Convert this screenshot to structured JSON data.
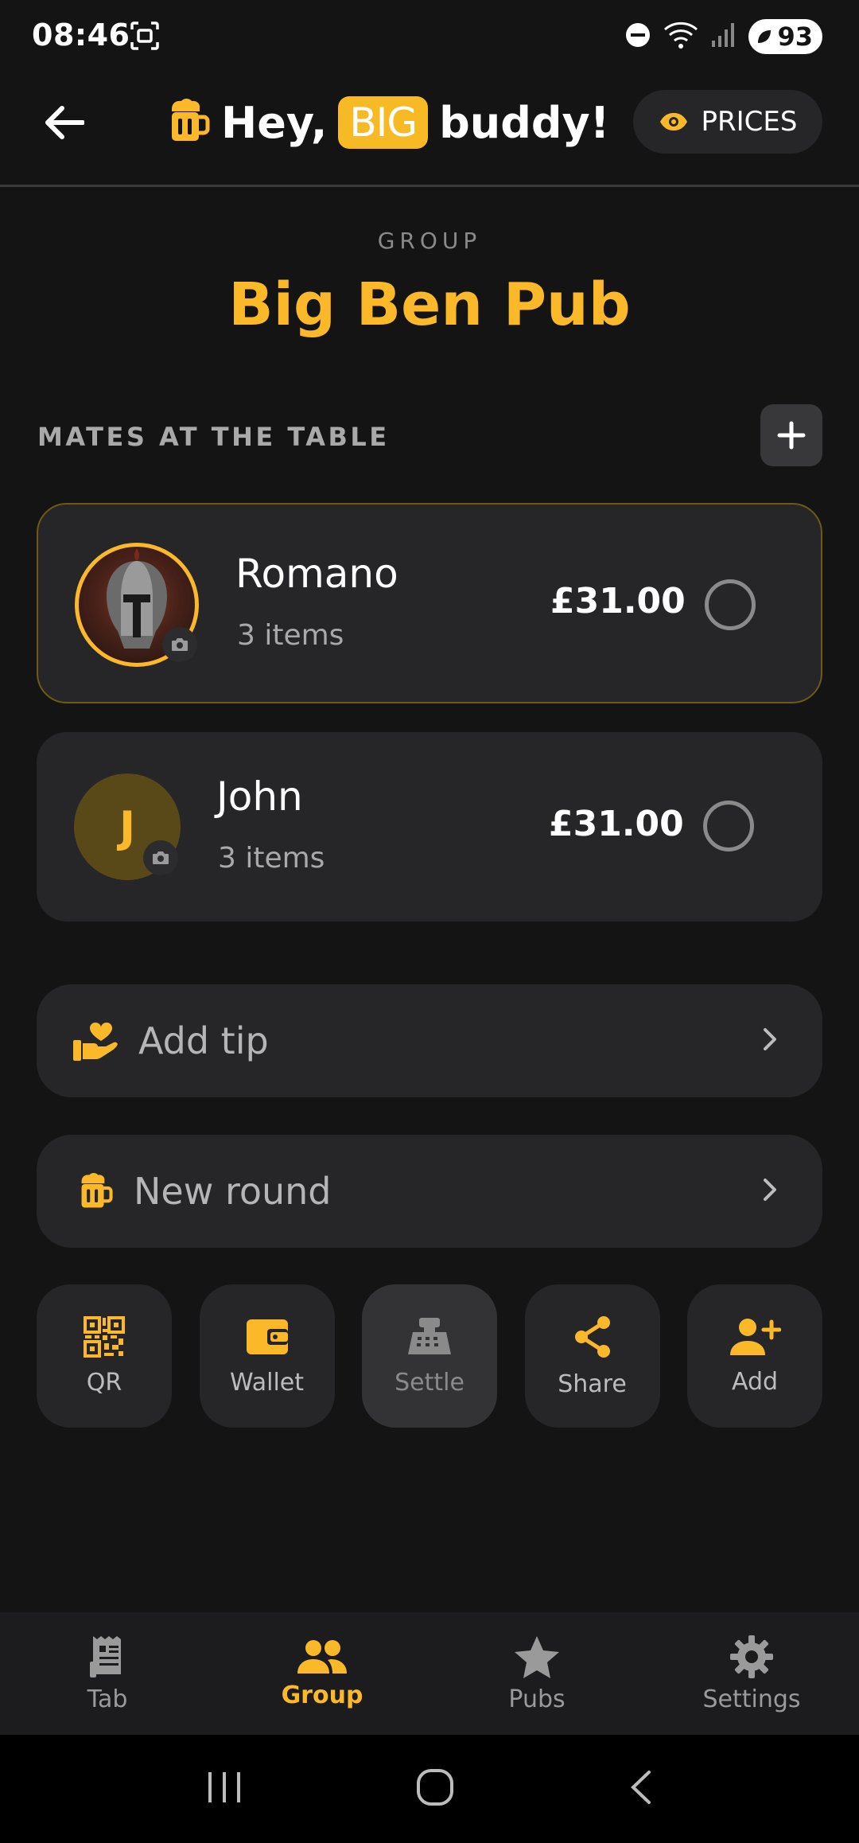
{
  "status_bar": {
    "time": "08:46",
    "battery": "93",
    "icons": [
      "screenshot-icon",
      "dnd-icon",
      "wifi-icon",
      "signal-icon",
      "battery-icon"
    ]
  },
  "header": {
    "greeting_prefix": "Hey,",
    "badge": "BIG",
    "greeting_suffix": "buddy!",
    "prices_label": "PRICES"
  },
  "group": {
    "label": "GROUP",
    "name": "Big Ben Pub"
  },
  "mates": {
    "heading": "MATES AT THE TABLE",
    "list": [
      {
        "name": "Romano",
        "items": "3 items",
        "amount": "£31.00",
        "avatar": "photo",
        "selected": true
      },
      {
        "name": "John",
        "items": "3 items",
        "amount": "£31.00",
        "avatar_letter": "J",
        "selected": false
      }
    ]
  },
  "actions": {
    "add_tip": "Add tip",
    "new_round": "New round"
  },
  "tiles": [
    {
      "label": "QR",
      "icon": "qr-icon"
    },
    {
      "label": "Wallet",
      "icon": "wallet-icon"
    },
    {
      "label": "Settle",
      "icon": "cash-register-icon"
    },
    {
      "label": "Share",
      "icon": "share-icon"
    },
    {
      "label": "Add",
      "icon": "add-person-icon"
    }
  ],
  "nav": [
    {
      "label": "Tab",
      "icon": "receipt-icon"
    },
    {
      "label": "Group",
      "icon": "group-icon",
      "active": true
    },
    {
      "label": "Pubs",
      "icon": "star-icon"
    },
    {
      "label": "Settings",
      "icon": "gear-icon"
    }
  ],
  "colors": {
    "accent": "#fbb92a",
    "background": "#141414",
    "card": "#262628"
  }
}
